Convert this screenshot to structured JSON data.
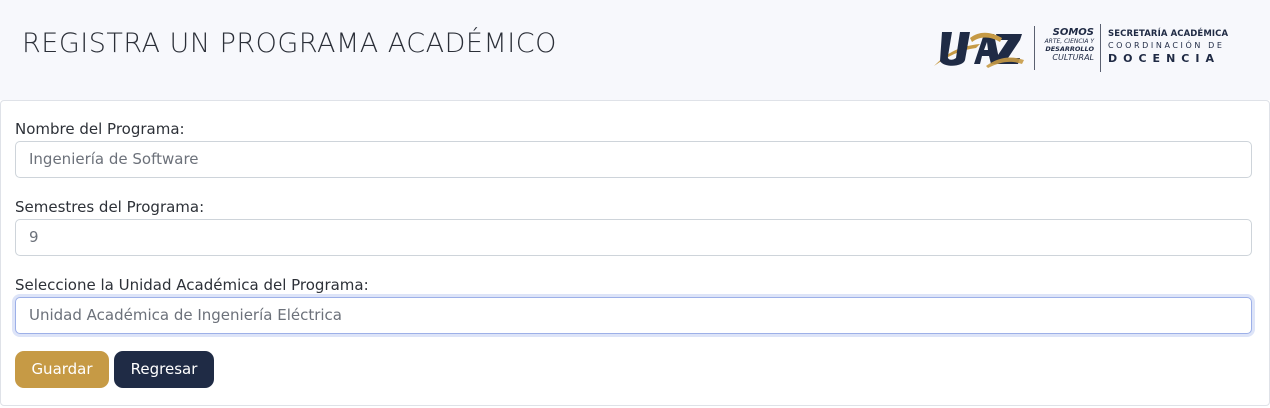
{
  "header": {
    "title": "REGISTRA UN PROGRAMA ACADÉMICO",
    "logo_uaz": "UAZ",
    "somos": {
      "word": "SOMOS",
      "line1": "ARTE, CIENCIA Y",
      "line2": "DESARROLLO",
      "line3": "CULTURAL"
    },
    "secretaria": {
      "line1": "SECRETARÍA ACADÉMICA",
      "line2": "COORDINACIÓN DE",
      "line3": "DOCENCIA"
    }
  },
  "form": {
    "nombre": {
      "label": "Nombre del Programa:",
      "value": "Ingeniería de Software"
    },
    "semestres": {
      "label": "Semestres del Programa:",
      "value": "9"
    },
    "unidad": {
      "label": "Seleccione la Unidad Académica del Programa:",
      "value": "Unidad Académica de Ingeniería Eléctrica"
    }
  },
  "buttons": {
    "guardar": "Guardar",
    "regresar": "Regresar"
  },
  "colors": {
    "header_bg": "#f7f8fc",
    "gold": "#c69a45",
    "navy": "#1f2b45",
    "focus_border": "#9db0e8"
  }
}
